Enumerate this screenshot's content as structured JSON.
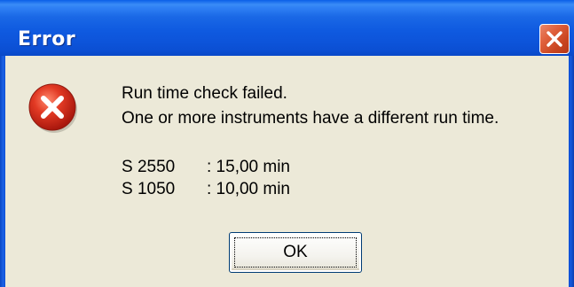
{
  "window": {
    "title": "Error"
  },
  "icons": {
    "error": "error-x-circle-icon",
    "close": "close-x-icon"
  },
  "message": {
    "line1": "Run time check failed.",
    "line2": "One or more instruments have a different run time."
  },
  "details": [
    {
      "name": "S 2550",
      "value": ": 15,00 min"
    },
    {
      "name": "S 1050",
      "value": ": 10,00 min"
    }
  ],
  "buttons": {
    "ok_label": "OK"
  },
  "colors": {
    "titlebar": "#0a5ee8",
    "dialog_background": "#ece9d8",
    "close_button": "#e0603c",
    "error_icon": "#d9261b"
  }
}
